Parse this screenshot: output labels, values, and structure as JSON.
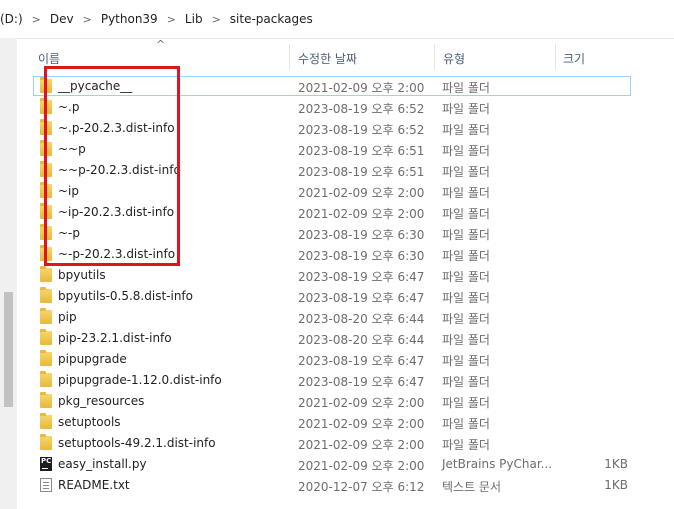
{
  "breadcrumb": {
    "drive": "(D:)",
    "items": [
      "Dev",
      "Python39",
      "Lib",
      "site-packages"
    ]
  },
  "columns": {
    "name": "이름",
    "date": "수정한 날짜",
    "type": "유형",
    "size": "크기"
  },
  "files": [
    {
      "name": "__pycache__",
      "date": "2021-02-09 오후 2:00",
      "type": "파일 폴더",
      "size": "",
      "icon": "folder-icon"
    },
    {
      "name": "~.p",
      "date": "2023-08-19 오후 6:52",
      "type": "파일 폴더",
      "size": "",
      "icon": "folder-icon"
    },
    {
      "name": "~.p-20.2.3.dist-info",
      "date": "2023-08-19 오후 6:52",
      "type": "파일 폴더",
      "size": "",
      "icon": "folder-icon"
    },
    {
      "name": "~~p",
      "date": "2023-08-19 오후 6:51",
      "type": "파일 폴더",
      "size": "",
      "icon": "folder-icon"
    },
    {
      "name": "~~p-20.2.3.dist-info",
      "date": "2023-08-19 오후 6:51",
      "type": "파일 폴더",
      "size": "",
      "icon": "folder-icon"
    },
    {
      "name": "~ip",
      "date": "2021-02-09 오후 2:00",
      "type": "파일 폴더",
      "size": "",
      "icon": "folder-icon"
    },
    {
      "name": "~ip-20.2.3.dist-info",
      "date": "2021-02-09 오후 2:00",
      "type": "파일 폴더",
      "size": "",
      "icon": "folder-icon"
    },
    {
      "name": "~-p",
      "date": "2023-08-19 오후 6:30",
      "type": "파일 폴더",
      "size": "",
      "icon": "folder-icon"
    },
    {
      "name": "~-p-20.2.3.dist-info",
      "date": "2023-08-19 오후 6:30",
      "type": "파일 폴더",
      "size": "",
      "icon": "folder-icon"
    },
    {
      "name": "bpyutils",
      "date": "2023-08-19 오후 6:47",
      "type": "파일 폴더",
      "size": "",
      "icon": "folder-icon"
    },
    {
      "name": "bpyutils-0.5.8.dist-info",
      "date": "2023-08-19 오후 6:47",
      "type": "파일 폴더",
      "size": "",
      "icon": "folder-icon"
    },
    {
      "name": "pip",
      "date": "2023-08-20 오후 6:44",
      "type": "파일 폴더",
      "size": "",
      "icon": "folder-icon"
    },
    {
      "name": "pip-23.2.1.dist-info",
      "date": "2023-08-20 오후 6:44",
      "type": "파일 폴더",
      "size": "",
      "icon": "folder-icon"
    },
    {
      "name": "pipupgrade",
      "date": "2023-08-19 오후 6:47",
      "type": "파일 폴더",
      "size": "",
      "icon": "folder-icon"
    },
    {
      "name": "pipupgrade-1.12.0.dist-info",
      "date": "2023-08-19 오후 6:47",
      "type": "파일 폴더",
      "size": "",
      "icon": "folder-icon"
    },
    {
      "name": "pkg_resources",
      "date": "2021-02-09 오후 2:00",
      "type": "파일 폴더",
      "size": "",
      "icon": "folder-icon"
    },
    {
      "name": "setuptools",
      "date": "2021-02-09 오후 2:00",
      "type": "파일 폴더",
      "size": "",
      "icon": "folder-icon"
    },
    {
      "name": "setuptools-49.2.1.dist-info",
      "date": "2021-02-09 오후 2:00",
      "type": "파일 폴더",
      "size": "",
      "icon": "folder-icon"
    },
    {
      "name": "easy_install.py",
      "date": "2021-02-09 오후 2:00",
      "type": "JetBrains PyChar...",
      "size": "1KB",
      "icon": "pycharm-file-icon"
    },
    {
      "name": "README.txt",
      "date": "2020-12-07 오후 6:12",
      "type": "텍스트 문서",
      "size": "1KB",
      "icon": "text-file-icon"
    }
  ],
  "pycharm_icon_text": "PC",
  "colors": {
    "annotation": "#e0141e",
    "selection_border": "#99d1ff",
    "folder": "#f5d66a"
  }
}
